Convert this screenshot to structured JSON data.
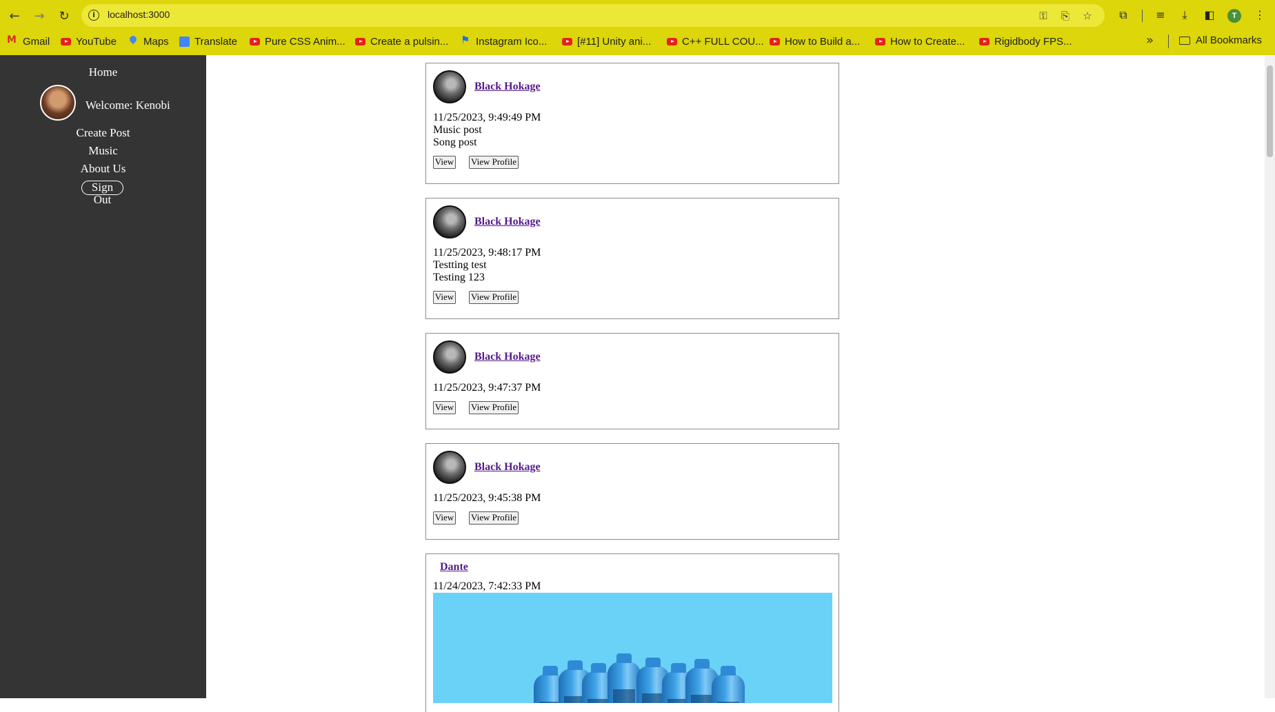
{
  "browser": {
    "url": "localhost:3000",
    "avatar_letter": "T",
    "bookmarks": [
      {
        "label": "Gmail",
        "icon": "gmail-icon"
      },
      {
        "label": "YouTube",
        "icon": "youtube-icon"
      },
      {
        "label": "Maps",
        "icon": "maps-icon"
      },
      {
        "label": "Translate",
        "icon": "translate-icon"
      },
      {
        "label": "Pure CSS Anim...",
        "icon": "youtube-icon"
      },
      {
        "label": "Create a pulsin...",
        "icon": "youtube-icon"
      },
      {
        "label": "Instagram Ico...",
        "icon": "flag-icon"
      },
      {
        "label": "[#11] Unity ani...",
        "icon": "youtube-icon"
      },
      {
        "label": "C++ FULL COU...",
        "icon": "youtube-icon"
      },
      {
        "label": "How to Build a...",
        "icon": "youtube-icon"
      },
      {
        "label": "How to Create...",
        "icon": "youtube-icon"
      },
      {
        "label": "Rigidbody FPS...",
        "icon": "youtube-icon"
      }
    ],
    "all_bookmarks": "All Bookmarks",
    "more_glyph": "»"
  },
  "sidebar": {
    "home": "Home",
    "welcome": "Welcome: Kenobi",
    "create_post": "Create Post",
    "music": "Music",
    "about": "About Us",
    "sign_out": "Sign Out"
  },
  "posts": [
    {
      "author": "Black Hokage",
      "date": "11/25/2023, 9:49:49 PM",
      "title": "Music post",
      "body": "Song post",
      "view": "View",
      "view_profile": "View Profile"
    },
    {
      "author": "Black Hokage",
      "date": "11/25/2023, 9:48:17 PM",
      "title": "Testting test",
      "body": "Testing 123",
      "view": "View",
      "view_profile": "View Profile"
    },
    {
      "author": "Black Hokage",
      "date": "11/25/2023, 9:47:37 PM",
      "view": "View",
      "view_profile": "View Profile"
    },
    {
      "author": "Black Hokage",
      "date": "11/25/2023, 9:45:38 PM",
      "view": "View",
      "view_profile": "View Profile"
    },
    {
      "author": "Dante",
      "date": "11/24/2023, 7:42:33 PM"
    }
  ],
  "colors": {
    "chrome": "#dcd60a",
    "sidebar": "#343434",
    "link": "#551a8b",
    "image_bg": "#6ad2f7"
  }
}
